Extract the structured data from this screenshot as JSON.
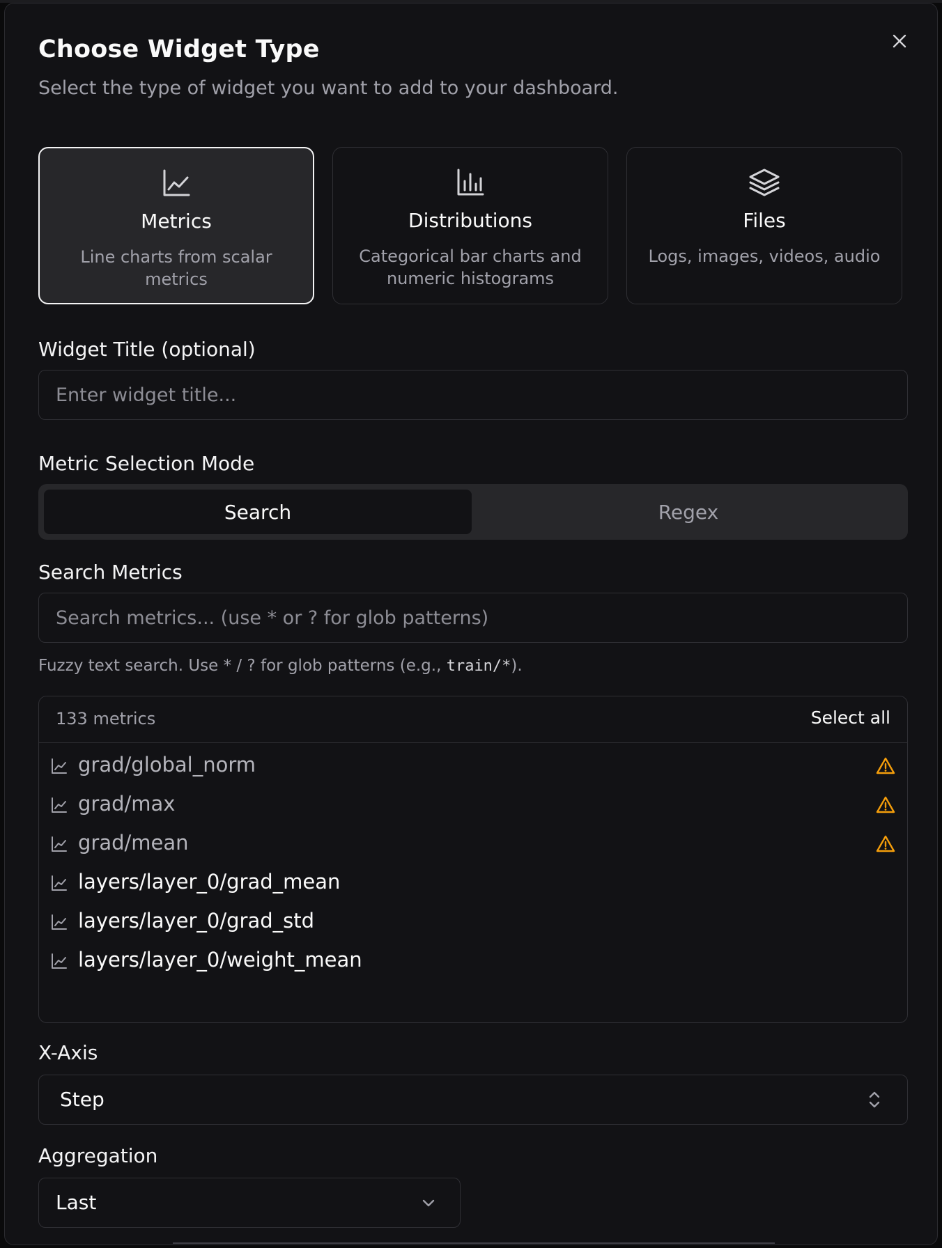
{
  "dialog": {
    "title": "Choose Widget Type",
    "subtitle": "Select the type of widget you want to add to your dashboard.",
    "close_icon": "close-icon"
  },
  "widget_types": [
    {
      "name": "Metrics",
      "description": "Line charts from scalar metrics",
      "icon": "line-chart-icon",
      "selected": true
    },
    {
      "name": "Distributions",
      "description": "Categorical bar charts and numeric histograms",
      "icon": "bar-chart-icon",
      "selected": false
    },
    {
      "name": "Files",
      "description": "Logs, images, videos, audio",
      "icon": "layers-icon",
      "selected": false
    }
  ],
  "widget_title": {
    "label": "Widget Title (optional)",
    "value": "",
    "placeholder": "Enter widget title..."
  },
  "selection_mode": {
    "label": "Metric Selection Mode",
    "options": [
      "Search",
      "Regex"
    ],
    "active": "Search"
  },
  "search_metrics": {
    "label": "Search Metrics",
    "value": "",
    "placeholder": "Search metrics... (use * or ? for glob patterns)",
    "hint_prefix": "Fuzzy text search. Use * / ? for glob patterns (e.g., ",
    "hint_code": "train/*",
    "hint_suffix": ")."
  },
  "metrics_list": {
    "count_label": "133 metrics",
    "select_all_label": "Select all",
    "items": [
      {
        "name": "grad/global_norm",
        "warning": true
      },
      {
        "name": "grad/max",
        "warning": true
      },
      {
        "name": "grad/mean",
        "warning": true
      },
      {
        "name": "layers/layer_0/grad_mean",
        "warning": false
      },
      {
        "name": "layers/layer_0/grad_std",
        "warning": false
      },
      {
        "name": "layers/layer_0/weight_mean",
        "warning": false
      }
    ]
  },
  "x_axis": {
    "label": "X-Axis",
    "value": "Step"
  },
  "aggregation": {
    "label": "Aggregation",
    "value": "Last"
  },
  "colors": {
    "background": "#121215",
    "border": "#2f2f34",
    "selected_card": "#27272a",
    "muted_text": "#a1a1aa",
    "warning": "#f59e0b"
  }
}
